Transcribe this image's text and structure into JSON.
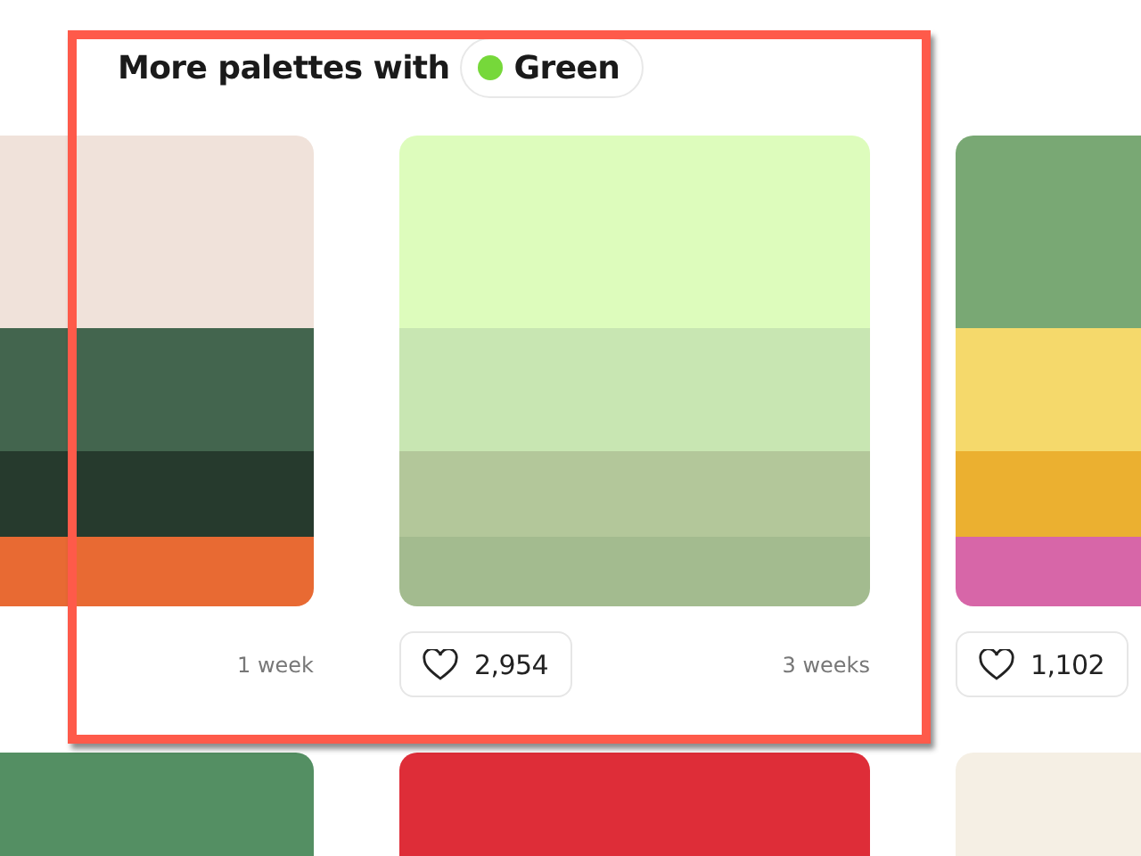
{
  "heading": {
    "text": "More palettes with",
    "tag": {
      "label": "Green",
      "color": "#76d83a"
    }
  },
  "palettes": [
    {
      "colors": [
        {
          "color": "#f0e2da"
        },
        {
          "color": "#43654e"
        },
        {
          "color": "#263a2d"
        },
        {
          "color": "#e86a33"
        }
      ],
      "time": "1 week"
    },
    {
      "colors": [
        {
          "color": "#ddfcbc"
        },
        {
          "color": "#c8e6b2"
        },
        {
          "color": "#b3c79a"
        },
        {
          "color": "#a3bb8f"
        }
      ],
      "likes": "2,954",
      "time": "3 weeks"
    },
    {
      "colors": [
        {
          "color": "#79a874"
        },
        {
          "color": "#f5d96b"
        },
        {
          "color": "#ebb030"
        },
        {
          "color": "#d766a8"
        }
      ],
      "likes": "1,102"
    },
    {
      "colors": [
        {
          "color": "#548f63"
        }
      ]
    },
    {
      "colors": [
        {
          "color": "#de2d38"
        }
      ]
    },
    {
      "colors": [
        {
          "color": "#f5efe4"
        }
      ]
    }
  ]
}
